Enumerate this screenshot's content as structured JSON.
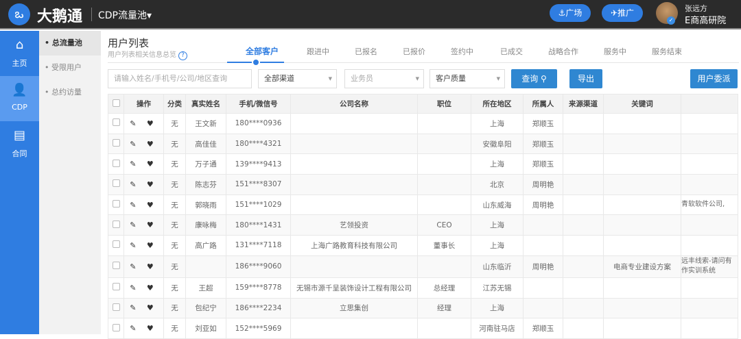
{
  "header": {
    "logo_glyph": "ఒ",
    "brand": "大鹅通",
    "pool": "CDP流量池▾",
    "square_btn": "⚓广场",
    "promote_btn": "✈推广",
    "user_name": "张远方",
    "user_org": "E商高研院"
  },
  "nav": [
    {
      "icon": "⌂",
      "label": "主页"
    },
    {
      "icon": "👤",
      "label": "CDP"
    },
    {
      "icon": "▤",
      "label": "合同"
    }
  ],
  "subnav": [
    "总流量池",
    "受限用户",
    "总约访量"
  ],
  "page": {
    "title": "用户列表",
    "subtitle": "用户列表相关信息总览",
    "help": "?"
  },
  "tabs": [
    "全部客户",
    "跟进中",
    "已报名",
    "已报价",
    "签约中",
    "已成交",
    "战略合作",
    "服务中",
    "服务结束"
  ],
  "filters": {
    "search_placeholder": "请输入姓名/手机号/公司/地区查询",
    "channel": "全部渠道",
    "salesman": "业务员",
    "quality": "客户质量",
    "query_btn": "查询 ⚲",
    "export_btn": "导出",
    "assign_btn": "用户委派"
  },
  "columns": [
    "",
    "操作",
    "分类",
    "真实姓名",
    "手机/微信号",
    "公司名称",
    "职位",
    "所在地区",
    "所属人",
    "来源渠道",
    "关键词",
    ""
  ],
  "rows": [
    [
      "无",
      "王文新",
      "180****0936",
      "",
      "",
      "上海",
      "郑顺玉",
      "",
      "",
      ""
    ],
    [
      "无",
      "高佳佳",
      "180****4321",
      "",
      "",
      "安徽阜阳",
      "郑顺玉",
      "",
      "",
      ""
    ],
    [
      "无",
      "万子通",
      "139****9413",
      "",
      "",
      "上海",
      "郑顺玉",
      "",
      "",
      ""
    ],
    [
      "无",
      "陈志芬",
      "151****8307",
      "",
      "",
      "北京",
      "周明艳",
      "",
      "",
      ""
    ],
    [
      "无",
      "郭晓雨",
      "151****1029",
      "",
      "",
      "山东威海",
      "周明艳",
      "",
      "",
      "青软软件公司,"
    ],
    [
      "无",
      "康咏梅",
      "180****1431",
      "艺领投资",
      "CEO",
      "上海",
      "",
      "",
      "",
      ""
    ],
    [
      "无",
      "高广路",
      "131****7118",
      "上海广路教育科技有限公司",
      "董事长",
      "上海",
      "",
      "",
      "",
      ""
    ],
    [
      "无",
      "",
      "186****9060",
      "",
      "",
      "山东临沂",
      "周明艳",
      "",
      "电商专业建设方案",
      "远丰线索-请问有作实训系统"
    ],
    [
      "无",
      "王超",
      "159****8778",
      "无锡市源千呈装饰设计工程有限公司",
      "总经理",
      "江苏无锡",
      "",
      "",
      "",
      ""
    ],
    [
      "无",
      "包纪宁",
      "186****2234",
      "立思集创",
      "经理",
      "上海",
      "",
      "",
      "",
      ""
    ],
    [
      "无",
      "刘亚如",
      "152****5969",
      "",
      "",
      "河南驻马店",
      "郑顺玉",
      "",
      "",
      ""
    ]
  ],
  "ops": "✎ ♥"
}
